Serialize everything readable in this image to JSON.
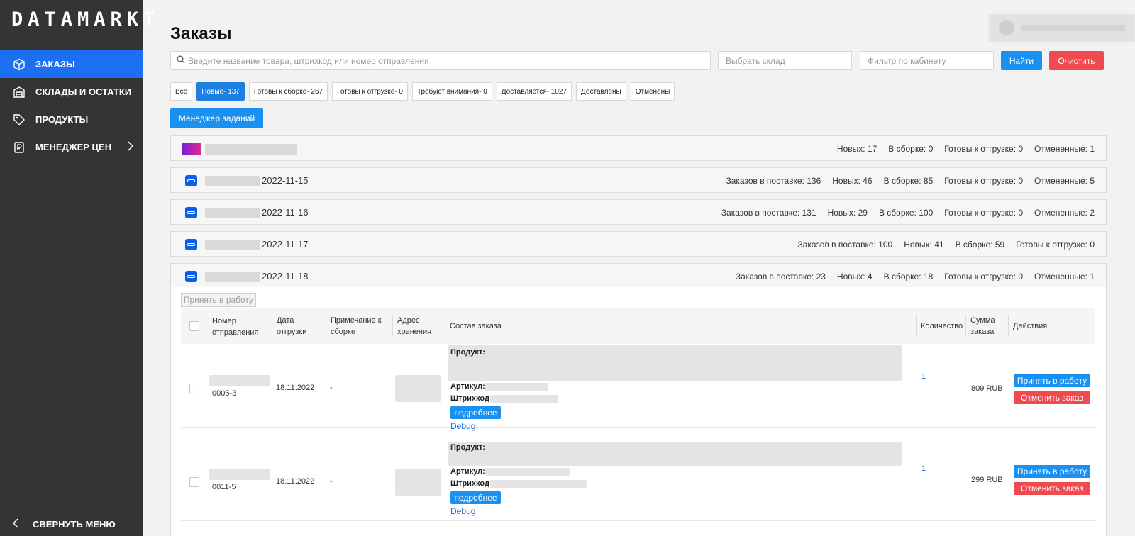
{
  "sidebar": {
    "logo": "DATAMARKT",
    "items": [
      {
        "label": "ЗАКАЗЫ",
        "icon": "box-icon",
        "active": true
      },
      {
        "label": "СКЛАДЫ И ОСТАТКИ",
        "icon": "warehouse-icon"
      },
      {
        "label": "ПРОДУКТЫ",
        "icon": "tag-icon"
      },
      {
        "label": "МЕНЕДЖЕР ЦЕН",
        "icon": "price-tag-icon",
        "has_submenu": true
      }
    ],
    "collapse_label": "СВЕРНУТЬ МЕНЮ"
  },
  "header": {
    "title": "Заказы"
  },
  "search": {
    "placeholder": "Введите название товара, штрихкод или номер отправления",
    "warehouse_placeholder": "Выбрать склад",
    "cabinet_placeholder": "Фильтр по кабинету",
    "find_label": "Найти",
    "clear_label": "Очистить"
  },
  "filters": [
    {
      "label": "Все"
    },
    {
      "label": "Новые- 137",
      "active": true
    },
    {
      "label": "Готовы к сборке- 267"
    },
    {
      "label": "Готовы к отгрузке- 0"
    },
    {
      "label": "Требуют внимания- 0"
    },
    {
      "label": "Доставляется- 1027"
    },
    {
      "label": "Доставлены"
    },
    {
      "label": "Отменены"
    }
  ],
  "task_manager_label": "Менеджер заданий",
  "supplies": [
    {
      "logo": "yandex-market",
      "date": "",
      "stats": [
        "Новых: 17",
        "В сборке: 0",
        "Готовы к отгрузке: 0",
        "Отмененные: 1"
      ]
    },
    {
      "logo": "ozon",
      "date": "2022-11-15",
      "stats": [
        "Заказов в поставке: 136",
        "Новых: 46",
        "В сборке: 85",
        "Готовы к отгрузке: 0",
        "Отмененные: 5"
      ]
    },
    {
      "logo": "ozon",
      "date": "2022-11-16",
      "stats": [
        "Заказов в поставке: 131",
        "Новых: 29",
        "В сборке: 100",
        "Готовы к отгрузке: 0",
        "Отмененные: 2"
      ]
    },
    {
      "logo": "ozon",
      "date": "2022-11-17",
      "stats": [
        "Заказов в поставке: 100",
        "Новых: 41",
        "В сборке: 59",
        "Готовы к отгрузке: 0"
      ]
    },
    {
      "logo": "ozon",
      "date": "2022-11-18",
      "stats": [
        "Заказов в поставке: 23",
        "Новых: 4",
        "В сборке: 18",
        "Готовы к отгрузке: 0",
        "Отмененные: 1"
      ]
    }
  ],
  "panel": {
    "take_to_work_label": "Принять в работу",
    "columns": {
      "shipment": "Номер отправления",
      "ship_date": "Дата отгрузки",
      "note": "Примечание к сборке",
      "address": "Адрес хранения",
      "composition": "Состав заказа",
      "quantity": "Количество",
      "sum": "Сумма заказа",
      "actions": "Действия"
    },
    "product_label": "Продукт:",
    "article_label": "Артикул:",
    "barcode_label": "Штрихкод:",
    "more_label": "подробнее",
    "debug_label": "Debug",
    "accept_label": "Принять в работу",
    "cancel_label": "Отменить заказ",
    "orders": [
      {
        "shipment_suffix": "0005-3",
        "date": "18.11.2022",
        "note": "-",
        "quantity": "1",
        "sum": "809 RUB"
      },
      {
        "shipment_suffix": "0011-5",
        "date": "18.11.2022",
        "note": "-",
        "quantity": "1",
        "sum": "299 RUB"
      }
    ]
  }
}
